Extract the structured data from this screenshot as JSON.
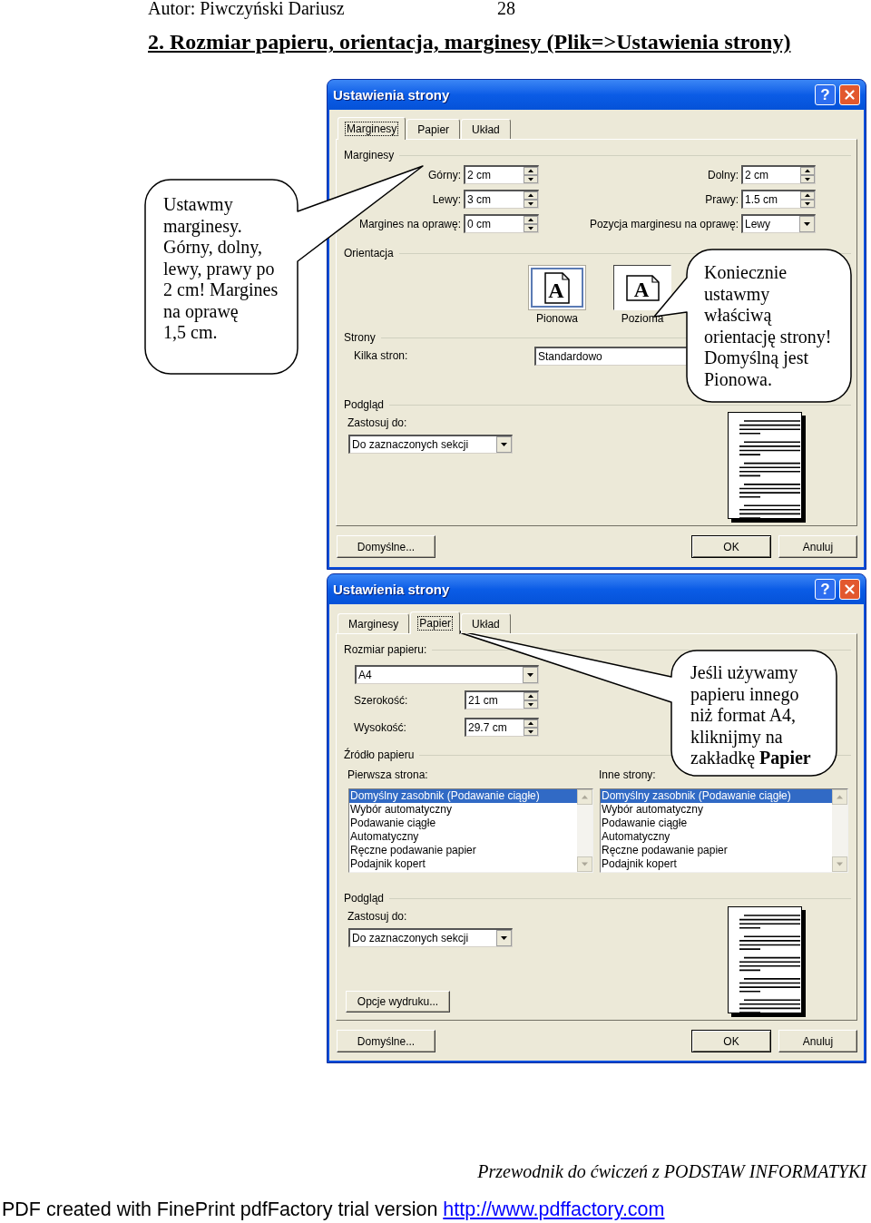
{
  "header": {
    "author": "Autor: Piwczyński Dariusz",
    "page_number": "28"
  },
  "heading": "2. Rozmiar papieru, orientacja, marginesy (Plik=>Ustawienia strony)",
  "dialogs": [
    {
      "kind": "margins",
      "title": "Ustawienia strony",
      "title_buttons": [
        {
          "kind": "help",
          "glyph": "?"
        },
        {
          "kind": "close"
        }
      ],
      "tabs": [
        {
          "label": "Marginesy",
          "selected": true
        },
        {
          "label": "Papier",
          "selected": false
        },
        {
          "label": "Układ",
          "selected": false
        }
      ],
      "margins": {
        "label": "Marginesy",
        "fields": [
          {
            "kind": "spin",
            "label": "Górny:",
            "value": "2 cm"
          },
          {
            "kind": "spin",
            "label": "Dolny:",
            "value": "2 cm"
          },
          {
            "kind": "spin",
            "label": "Lewy:",
            "value": "3 cm"
          },
          {
            "kind": "spin",
            "label": "Prawy:",
            "value": "1.5 cm"
          },
          {
            "kind": "spin",
            "label": "Margines na oprawę:",
            "value": "0 cm"
          },
          {
            "kind": "dropdown",
            "label": "Pozycja marginesu na oprawę:",
            "value": "Lewy"
          }
        ]
      },
      "orientation": {
        "label": "Orientacja",
        "options": [
          {
            "kind": "portrait",
            "glyph": "A",
            "label": "Pionowa",
            "selected": true
          },
          {
            "kind": "landscape",
            "glyph": "A",
            "label": "Pozioma",
            "selected": false
          }
        ]
      },
      "pages": {
        "label": "Strony",
        "field_label": "Kilka stron:",
        "value": "Standardowo"
      },
      "preview": {
        "label": "Podgląd",
        "apply_label": "Zastosuj do:",
        "apply_value": "Do zaznaczonych sekcji"
      },
      "buttons": [
        {
          "label": "Domyślne...",
          "default": false
        },
        {
          "label": "OK",
          "default": true
        },
        {
          "label": "Anuluj",
          "default": false
        }
      ]
    },
    {
      "kind": "paper",
      "title": "Ustawienia strony",
      "title_buttons": [
        {
          "kind": "help",
          "glyph": "?"
        },
        {
          "kind": "close"
        }
      ],
      "tabs": [
        {
          "label": "Marginesy",
          "selected": false
        },
        {
          "label": "Papier",
          "selected": true
        },
        {
          "label": "Układ",
          "selected": false
        }
      ],
      "paper_size": {
        "label": "Rozmiar papieru:",
        "value": "A4",
        "fields": [
          {
            "label": "Szerokość:",
            "value": "21 cm"
          },
          {
            "label": "Wysokość:",
            "value": "29.7 cm"
          }
        ]
      },
      "paper_source": {
        "label": "Źródło papieru",
        "lists": [
          {
            "label": "Pierwsza strona:",
            "items": [
              {
                "text": "Domyślny zasobnik (Podawanie ciągłe)",
                "selected": true
              },
              {
                "text": "Wybór automatyczny",
                "selected": false
              },
              {
                "text": "Podawanie ciągłe",
                "selected": false
              },
              {
                "text": "Automatyczny",
                "selected": false
              },
              {
                "text": "Ręczne podawanie papier",
                "selected": false
              },
              {
                "text": "Podajnik kopert",
                "selected": false
              }
            ]
          },
          {
            "label": "Inne strony:",
            "items": [
              {
                "text": "Domyślny zasobnik (Podawanie ciągłe)",
                "selected": true
              },
              {
                "text": "Wybór automatyczny",
                "selected": false
              },
              {
                "text": "Podawanie ciągłe",
                "selected": false
              },
              {
                "text": "Automatyczny",
                "selected": false
              },
              {
                "text": "Ręczne podawanie papier",
                "selected": false
              },
              {
                "text": "Podajnik kopert",
                "selected": false
              }
            ]
          }
        ]
      },
      "preview": {
        "label": "Podgląd",
        "apply_label": "Zastosuj do:",
        "apply_value": "Do zaznaczonych sekcji",
        "options_button": "Opcje wydruku..."
      },
      "buttons": [
        {
          "label": "Domyślne...",
          "default": false
        },
        {
          "label": "OK",
          "default": true
        },
        {
          "label": "Anuluj",
          "default": false
        }
      ]
    }
  ],
  "callouts": [
    {
      "text": "Ustawmy marginesy. Górny, dolny, lewy, prawy po 2 cm! Margines na oprawę 1,5 cm."
    },
    {
      "text": "Koniecznie ustawmy właściwą orientację strony! Domyślną jest Pionowa."
    },
    {
      "text": "Jeśli używamy papieru innego niż format A4, kliknijmy na zakładkę **Papier**"
    }
  ],
  "footer": "Przewodnik do ćwiczeń z PODSTAW INFORMATYKI",
  "pdf_notice": {
    "text": "PDF created with FinePrint pdfFactory trial version",
    "link": "http://www.pdffactory.com"
  }
}
